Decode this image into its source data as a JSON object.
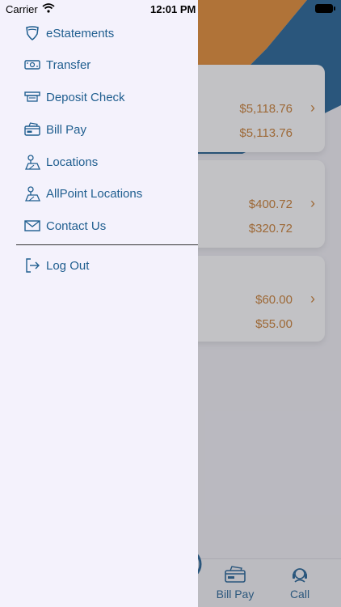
{
  "status_bar": {
    "carrier": "Carrier",
    "time": "12:01 PM"
  },
  "menu": {
    "items": [
      {
        "label": "eStatements",
        "icon": "shield-icon"
      },
      {
        "label": "Transfer",
        "icon": "transfer-icon"
      },
      {
        "label": "Deposit Check",
        "icon": "deposit-check-icon"
      },
      {
        "label": "Bill Pay",
        "icon": "bill-pay-icon"
      },
      {
        "label": "Locations",
        "icon": "map-pin-icon"
      },
      {
        "label": "AllPoint Locations",
        "icon": "map-pin-icon"
      },
      {
        "label": "Contact Us",
        "icon": "envelope-icon"
      }
    ],
    "logout": {
      "label": "Log Out",
      "icon": "logout-icon"
    }
  },
  "accounts": [
    {
      "balance": "$5,118.76",
      "available": "$5,113.76"
    },
    {
      "balance": "$400.72",
      "available": "$320.72"
    },
    {
      "balance": "$60.00",
      "available": "$55.00"
    }
  ],
  "tabbar": {
    "bill_pay": "Bill Pay",
    "call": "Call"
  },
  "colors": {
    "accent": "#1f5e8f",
    "amount": "#c87a2a",
    "banner_orange": "#e58a2e",
    "banner_blue": "#1d5f93"
  }
}
